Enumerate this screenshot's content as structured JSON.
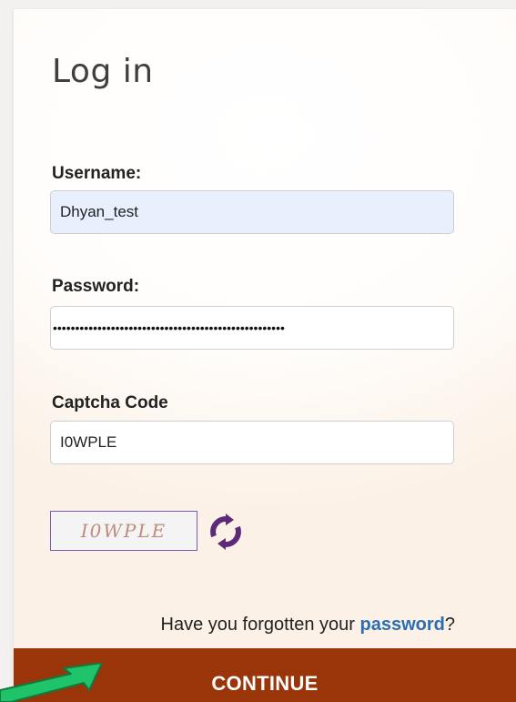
{
  "login": {
    "title": "Log in",
    "username_label": "Username:",
    "username_value": "Dhyan_test",
    "password_label": "Password:",
    "password_value": "••••••••••••••••••••••••••••••••••••••••••••••••••••",
    "captcha_label": "Captcha Code",
    "captcha_value": "I0WPLE",
    "captcha_image_text": "I0WPLE",
    "refresh_icon": "refresh-icon",
    "forgot_prefix": "Have you forgotten your ",
    "forgot_link": "password",
    "forgot_suffix": "?",
    "continue_label": "CONTINUE"
  },
  "colors": {
    "continue_bg": "#9a350a",
    "link": "#2b6fb2",
    "refresh_icon": "#5b2b7a",
    "annotation_arrow": "#1fc46a"
  }
}
